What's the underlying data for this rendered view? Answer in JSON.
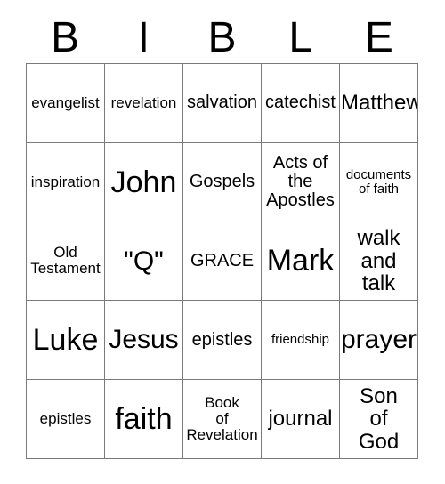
{
  "card": {
    "title_letters": [
      "B",
      "I",
      "B",
      "L",
      "E"
    ],
    "rows": [
      [
        {
          "text": "evangelist",
          "size": "fs-sm"
        },
        {
          "text": "revelation",
          "size": "fs-sm"
        },
        {
          "text": "salvation",
          "size": "fs-md"
        },
        {
          "text": "catechist",
          "size": "fs-md"
        },
        {
          "text": "Matthew",
          "size": "fs-lg"
        }
      ],
      [
        {
          "text": "inspiration",
          "size": "fs-sm"
        },
        {
          "text": "John",
          "size": "fs-xxl"
        },
        {
          "text": "Gospels",
          "size": "fs-md"
        },
        {
          "text": "Acts of\nthe\nApostles",
          "size": "fs-md"
        },
        {
          "text": "documents\nof faith",
          "size": "fs-xs"
        }
      ],
      [
        {
          "text": "Old\nTestament",
          "size": "fs-sm"
        },
        {
          "text": "\"Q\"",
          "size": "fs-xl"
        },
        {
          "text": "GRACE",
          "size": "fs-md"
        },
        {
          "text": "Mark",
          "size": "fs-xxl"
        },
        {
          "text": "walk\nand\ntalk",
          "size": "fs-lg"
        }
      ],
      [
        {
          "text": "Luke",
          "size": "fs-xxl"
        },
        {
          "text": "Jesus",
          "size": "fs-xl"
        },
        {
          "text": "epistles",
          "size": "fs-md"
        },
        {
          "text": "friendship",
          "size": "fs-xs"
        },
        {
          "text": "prayer",
          "size": "fs-xl"
        }
      ],
      [
        {
          "text": "epistles",
          "size": "fs-sm"
        },
        {
          "text": "faith",
          "size": "fs-xxl"
        },
        {
          "text": "Book\nof\nRevelation",
          "size": "fs-sm"
        },
        {
          "text": "journal",
          "size": "fs-lg"
        },
        {
          "text": "Son\nof\nGod",
          "size": "fs-lg"
        }
      ]
    ]
  }
}
